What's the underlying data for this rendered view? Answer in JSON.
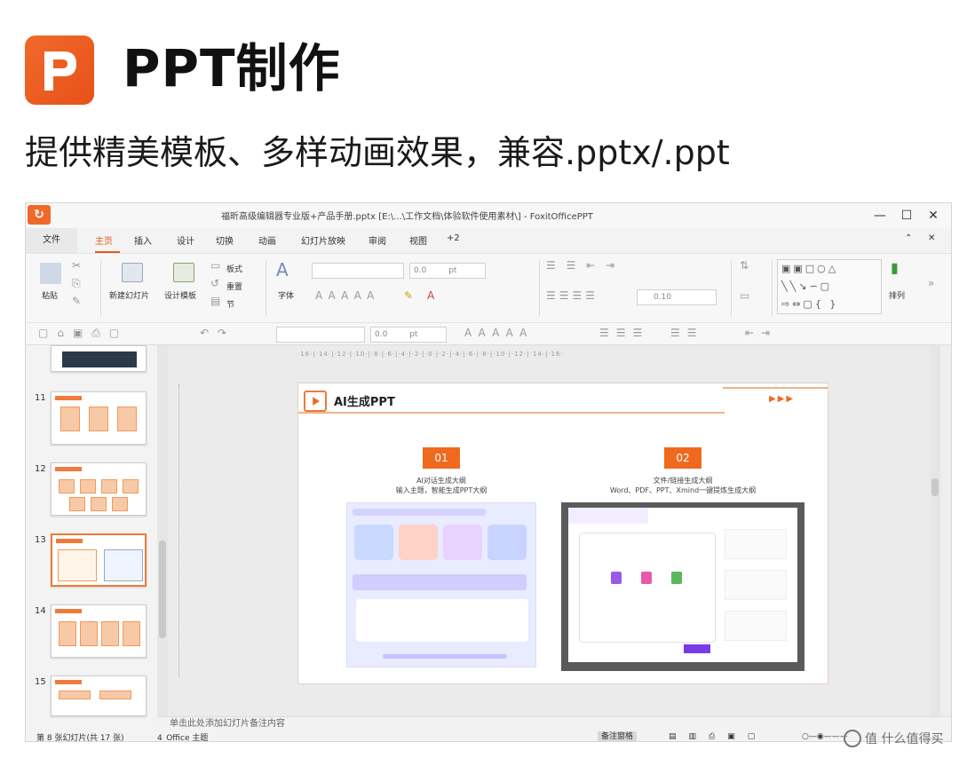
{
  "header": {
    "logo_letter": "P",
    "title": "PPT制作",
    "subtitle": "提供精美模板、多样动画效果，兼容.pptx/.ppt",
    "brand_color": "#ef6a2a"
  },
  "window": {
    "app_icon": "app-logo-icon",
    "title": "福昕高级编辑器专业版+产品手册.pptx [E:\\...\\工作文档\\体验软件使用素材\\] - FoxitOfficePPT",
    "controls": {
      "minimize": "—",
      "maximize": "☐",
      "close": "✕"
    }
  },
  "tabs": [
    "文件",
    "主页",
    "插入",
    "设计",
    "切换",
    "动画",
    "幻灯片放映",
    "审阅",
    "视图",
    "+2"
  ],
  "active_tab": "主页",
  "ribbon": {
    "paste": "粘贴",
    "new_slide": "新建幻灯片",
    "design_template": "设计模板",
    "layout": "板式",
    "reset": "重置",
    "section": "节",
    "font_label": "字体",
    "font_size": "0.0",
    "font_unit": "pt",
    "spacing_value": "0.10",
    "arrange": "排列"
  },
  "qat": {
    "font_size": "0.0",
    "font_unit": "pt"
  },
  "thumbnails": [
    {
      "num": ""
    },
    {
      "num": "11"
    },
    {
      "num": "12"
    },
    {
      "num": "13"
    },
    {
      "num": "14"
    },
    {
      "num": "15"
    }
  ],
  "ruler": "·16·|·14·|·12·|·10·|·8·|·6·|·4·|·2·|·0·|·2·|·4·|·6·|·8·|·10·|·12·|·14·|·16·",
  "slide": {
    "title": "AI生成PPT",
    "arrows": "▶▶▶",
    "col1": {
      "badge": "01",
      "line1": "AI对话生成大纲",
      "line2": "输入主题，智能生成PPT大纲"
    },
    "col2": {
      "badge": "02",
      "line1": "文件/链接生成大纲",
      "line2": "Word、PDF、PPT、Xmind一键提炼生成大纲"
    }
  },
  "notes_placeholder": "单击此处添加幻灯片备注内容",
  "status": {
    "slide_info": "第 8 张幻灯片(共 17 张)",
    "theme": "4_Office 主题",
    "notes_toggle": "备注窗格"
  },
  "watermark": "值 什么值得买"
}
